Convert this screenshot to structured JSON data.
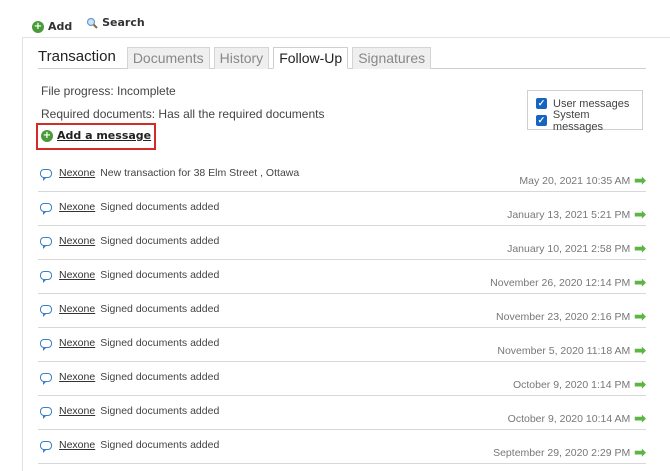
{
  "toolbar": {
    "add_label": "Add",
    "search_label": "Search"
  },
  "tabs": {
    "transaction": "Transaction",
    "documents": "Documents",
    "history": "History",
    "follow_up": "Follow-Up",
    "signatures": "Signatures"
  },
  "status": {
    "progress": "File progress: Incomplete",
    "required": "Required documents: Has all the required documents"
  },
  "add_message_label": "Add a message",
  "filters": {
    "user_messages": "User messages",
    "system_messages": "System messages"
  },
  "messages": [
    {
      "user": "Nexone",
      "text": "New transaction for 38 Elm Street , Ottawa",
      "date": "May 20, 2021 10:35 AM"
    },
    {
      "user": "Nexone",
      "text": "Signed documents added",
      "date": "January 13, 2021 5:21 PM"
    },
    {
      "user": "Nexone",
      "text": "Signed documents added",
      "date": "January 10, 2021 2:58 PM"
    },
    {
      "user": "Nexone",
      "text": "Signed documents added",
      "date": "November 26, 2020 12:14 PM"
    },
    {
      "user": "Nexone",
      "text": "Signed documents added",
      "date": "November 23, 2020 2:16 PM"
    },
    {
      "user": "Nexone",
      "text": "Signed documents added",
      "date": "November 5, 2020 11:18 AM"
    },
    {
      "user": "Nexone",
      "text": "Signed documents added",
      "date": "October 9, 2020 1:14 PM"
    },
    {
      "user": "Nexone",
      "text": "Signed documents added",
      "date": "October 9, 2020 10:14 AM"
    },
    {
      "user": "Nexone",
      "text": "Signed documents added",
      "date": "September 29, 2020 2:29 PM"
    }
  ]
}
